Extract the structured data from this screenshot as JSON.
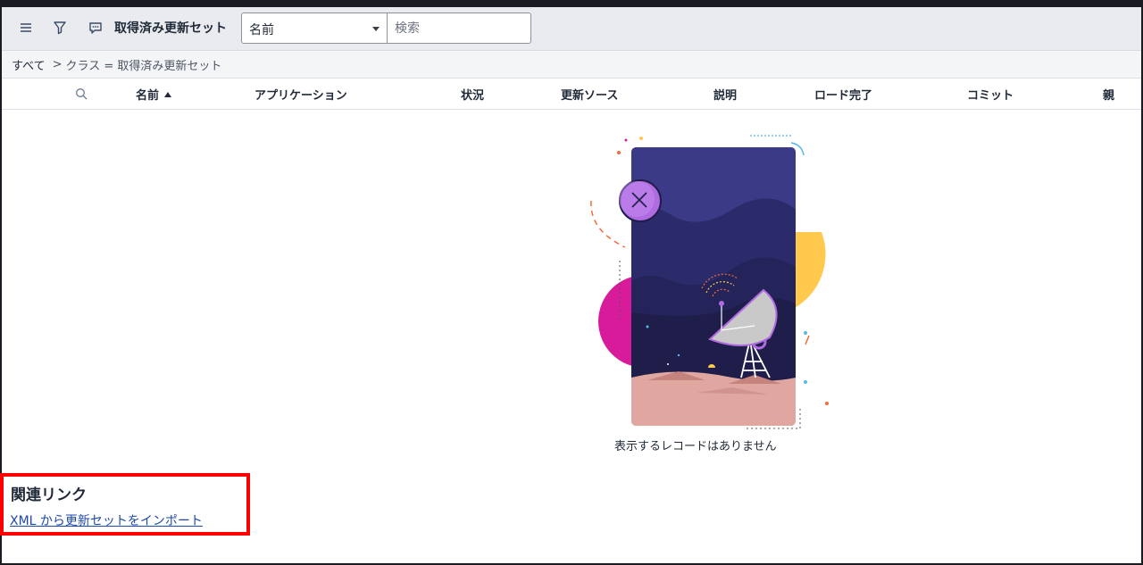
{
  "toolbar": {
    "icons": [
      "hamburger-menu-icon",
      "filter-icon",
      "chat-bubble-icon"
    ],
    "title": "取得済み更新セット",
    "select_value": "名前",
    "search_placeholder": "検索"
  },
  "breadcrumb": {
    "root": "すべて",
    "separator": ">",
    "crumb": "クラス = 取得済み更新セット"
  },
  "table": {
    "columns": [
      {
        "label": "名前",
        "sorted": "ascending"
      },
      {
        "label": "アプリケーション"
      },
      {
        "label": "状況"
      },
      {
        "label": "更新ソース"
      },
      {
        "label": "説明"
      },
      {
        "label": "ロード完了"
      },
      {
        "label": "コミット"
      },
      {
        "label": "親"
      }
    ],
    "rows": []
  },
  "empty_state": {
    "message": "表示するレコードはありません",
    "illustration": "satellite-dish-night-scene"
  },
  "related_links": {
    "title": "関連リンク",
    "links": [
      "XML から更新セットをインポート"
    ]
  },
  "colors": {
    "accent_link": "#1f4aa8",
    "highlight_box": "#ff0000",
    "toolbar_bg": "#e9ebef"
  }
}
